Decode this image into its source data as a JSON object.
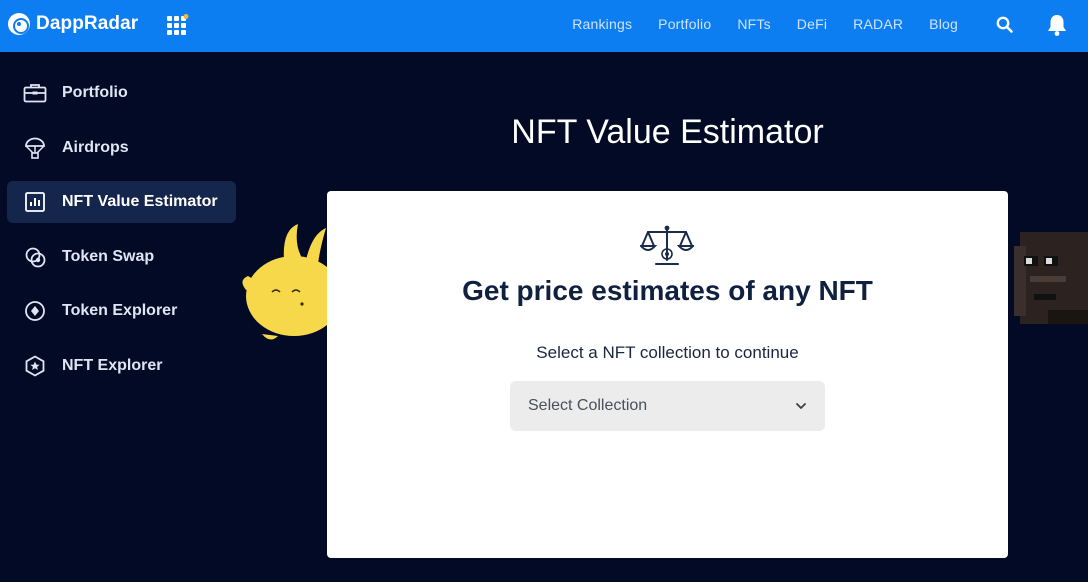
{
  "header": {
    "logo_text": "DappRadar",
    "nav": [
      "Rankings",
      "Portfolio",
      "NFTs",
      "DeFi",
      "RADAR",
      "Blog"
    ]
  },
  "sidebar": {
    "items": [
      {
        "label": "Portfolio",
        "icon": "briefcase-icon"
      },
      {
        "label": "Airdrops",
        "icon": "parachute-icon"
      },
      {
        "label": "NFT Value Estimator",
        "icon": "bar-chart-icon",
        "active": true
      },
      {
        "label": "Token Swap",
        "icon": "swap-icon"
      },
      {
        "label": "Token Explorer",
        "icon": "token-icon"
      },
      {
        "label": "NFT Explorer",
        "icon": "nft-badge-icon"
      }
    ]
  },
  "main": {
    "title": "NFT Value Estimator",
    "card": {
      "heading": "Get price estimates of any NFT",
      "subtitle": "Select a NFT collection to continue",
      "select_value": "Select Collection"
    }
  },
  "colors": {
    "topbar": "#0d7ef2",
    "background": "#020a25",
    "sidebar_active": "#15264d",
    "card_text": "#10213f"
  }
}
